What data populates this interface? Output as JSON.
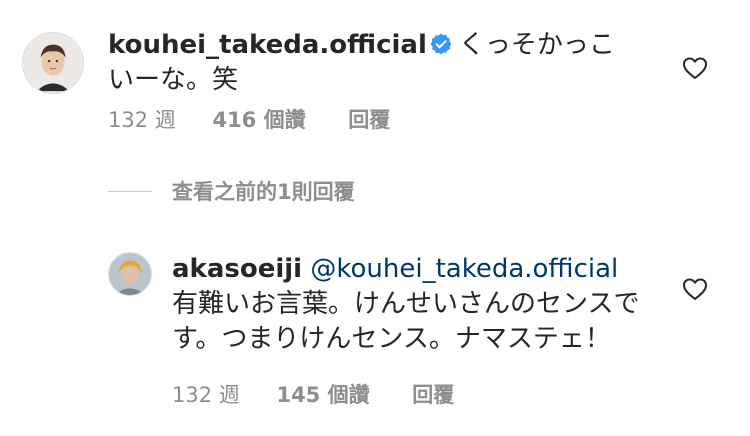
{
  "comments": [
    {
      "username": "kouhei_takeda.official",
      "verified": true,
      "text": "くっそかっこいーな。笑",
      "time": "132 週",
      "likes": "416 個讚",
      "reply_label": "回覆",
      "avatar_icon": "profile-photo"
    },
    {
      "username": "akasoeiji",
      "mention": "@kouhei_takeda.official",
      "text": "有難いお言葉。けんせいさんのセンスです。つまりけんセンス。ナマステェ！",
      "time": "132 週",
      "likes": "145 個讚",
      "reply_label": "回覆",
      "avatar_icon": "profile-photo"
    }
  ],
  "view_previous_replies": "查看之前的1則回覆",
  "icons": {
    "like": "heart-outline-icon",
    "verified": "verified-badge-icon"
  },
  "colors": {
    "text": "#262626",
    "secondary": "#8e8e8e",
    "mention": "#00376b",
    "verified": "#3897f0"
  }
}
